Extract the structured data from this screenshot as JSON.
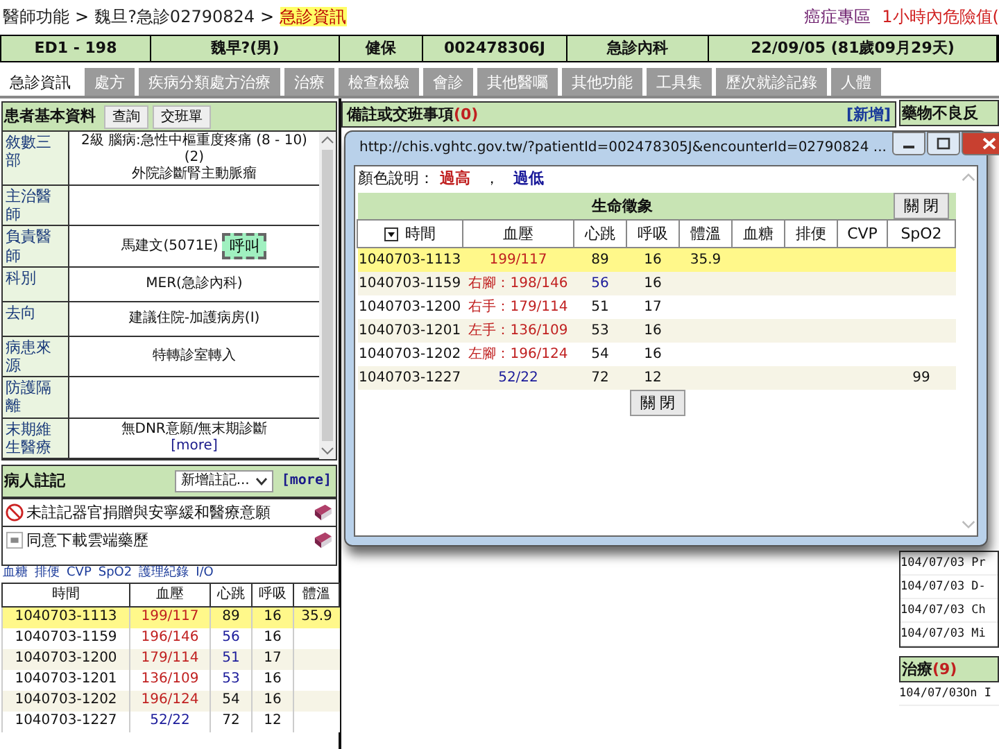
{
  "breadcrumb": [
    {
      "text": "醫師功能",
      "current": false
    },
    {
      "prefix": ">",
      "text": "魏旦?急診02790824",
      "current": false
    },
    {
      "prefix": ">",
      "text": "急診資訊",
      "current": true
    }
  ],
  "top_links": [
    {
      "text": "癌症專區",
      "kind": "info"
    },
    {
      "text": "1小時內危險值(",
      "kind": "alert"
    }
  ],
  "patient_bar": [
    "ED1 - 198",
    "魏早?(男)",
    "健保",
    "002478306J",
    "急診內科",
    "22/09/05 (81歲09月29天)"
  ],
  "tabs": [
    {
      "label": "急診資訊",
      "selected": true
    },
    {
      "label": "處方",
      "selected": false
    },
    {
      "label": "疾病分類處方治療",
      "selected": false
    },
    {
      "label": "治療",
      "selected": false
    },
    {
      "label": "檢查檢驗",
      "selected": false
    },
    {
      "label": "會診",
      "selected": false
    },
    {
      "label": "其他醫囑",
      "selected": false
    },
    {
      "label": "其他功能",
      "selected": false
    },
    {
      "label": "工具集",
      "selected": false
    },
    {
      "label": "歷次就診記錄",
      "selected": false
    },
    {
      "label": "人體",
      "selected": false
    }
  ],
  "basic_info": {
    "title": "患者基本資料",
    "buttons": [
      "查詢",
      "交班單"
    ],
    "rows": [
      {
        "label": "敘數三部",
        "lines": [
          "2級 腦病:急性中樞重度疼痛 (8 - 10)(2)",
          "外院診斷腎主動脈瘤"
        ]
      },
      {
        "label": "主治醫師",
        "lines": []
      },
      {
        "label": "負責醫師",
        "lines": [
          "馬建文(5071E)"
        ],
        "action": "呼叫"
      },
      {
        "label": "科別",
        "lines": [
          "MER(急診內科)"
        ]
      },
      {
        "label": "去向",
        "lines": [
          "建議住院-加護病房(I)"
        ]
      },
      {
        "label": "病患來源",
        "lines": [
          "特轉診室轉入"
        ]
      },
      {
        "label": "防護隔離",
        "lines": []
      },
      {
        "label": "末期維生醫療",
        "lines": [
          "無DNR意願/無末期診斷"
        ],
        "link": "[more]"
      }
    ]
  },
  "notes": {
    "title": "病人註記",
    "select": "新增註記...",
    "more": "[more]",
    "items": [
      {
        "text": "未註記器官捐贈與安寧緩和醫療意願",
        "kind": "prohibit"
      },
      {
        "text": "同意下載雲端藥歷",
        "kind": "note"
      }
    ]
  },
  "nav_links": [
    "血糖",
    "排便",
    "CVP",
    "SpO2",
    "護理紀錄",
    "I/O"
  ],
  "mini_vitals": {
    "columns": [
      "時間",
      "血壓",
      "心跳",
      "呼吸",
      "體溫"
    ],
    "rows": [
      {
        "time": "1040703-1113",
        "bp": "199/117",
        "bp_high": true,
        "bp_low": false,
        "hr": "89",
        "hr_low": false,
        "rr": "16",
        "temp": "35.9",
        "selected": true
      },
      {
        "time": "1040703-1159",
        "bp": "196/146",
        "bp_high": true,
        "bp_low": false,
        "hr": "56",
        "hr_low": true,
        "rr": "16",
        "selected": false
      },
      {
        "time": "1040703-1200",
        "bp": "179/114",
        "bp_high": true,
        "bp_low": false,
        "hr": "51",
        "hr_low": true,
        "rr": "17",
        "selected": false
      },
      {
        "time": "1040703-1201",
        "bp": "136/109",
        "bp_high": true,
        "bp_low": false,
        "hr": "53",
        "hr_low": true,
        "rr": "16",
        "selected": false
      },
      {
        "time": "1040703-1202",
        "bp": "196/124",
        "bp_high": true,
        "bp_low": false,
        "hr": "54",
        "hr_low": false,
        "rr": "16",
        "selected": false
      },
      {
        "time": "1040703-1227",
        "bp": "52/22",
        "bp_high": false,
        "bp_low": true,
        "hr": "72",
        "hr_low": false,
        "rr": "12",
        "selected": false
      }
    ]
  },
  "memo": {
    "title": "備註或交班事項",
    "count": "(0)",
    "add": "[新增]"
  },
  "adr": {
    "title": "藥物不良反",
    "rows": [
      "104/07/03 Pr",
      "104/07/03 D-",
      "104/07/03 Ch",
      "104/07/03 Mi"
    ]
  },
  "treatment": {
    "title": "治療",
    "count": "(9)",
    "rows": [
      "104/07/03On I"
    ]
  },
  "popup": {
    "url": "http://chis.vghtc.gov.tw/?patientId=002478305J&encounterId=02790824 ...",
    "legend": {
      "label": "顏色說明：",
      "high": "過高",
      "sep": "，",
      "low": "過低"
    },
    "title": "生命徵象",
    "close_top": "關 閉",
    "close_bottom": "關 閉",
    "columns": [
      "時間",
      "血壓",
      "心跳",
      "呼吸",
      "體溫",
      "血糖",
      "排便",
      "CVP",
      "SpO2"
    ],
    "rows": [
      {
        "time": "1040703-1113",
        "bp": "199/117",
        "bp_high": true,
        "bp_low": false,
        "hr": "89",
        "hr_low": false,
        "rr": "16",
        "temp": "35.9",
        "selected": true
      },
      {
        "time": "1040703-1159",
        "bp": "右腳：198/146",
        "bp_high": true,
        "bp_low": false,
        "hr": "56",
        "hr_low": true,
        "rr": "16",
        "selected": false
      },
      {
        "time": "1040703-1200",
        "bp": "右手：179/114",
        "bp_high": true,
        "bp_low": false,
        "hr": "51",
        "hr_low": false,
        "rr": "17",
        "selected": false
      },
      {
        "time": "1040703-1201",
        "bp": "左手：136/109",
        "bp_high": true,
        "bp_low": false,
        "hr": "53",
        "hr_low": false,
        "rr": "16",
        "selected": false
      },
      {
        "time": "1040703-1202",
        "bp": "左腳：196/124",
        "bp_high": true,
        "bp_low": false,
        "hr": "54",
        "hr_low": false,
        "rr": "16",
        "selected": false
      },
      {
        "time": "1040703-1227",
        "bp": "52/22",
        "bp_high": false,
        "bp_low": true,
        "hr": "72",
        "hr_low": false,
        "rr": "12",
        "spo2": "99",
        "selected": false
      }
    ]
  }
}
